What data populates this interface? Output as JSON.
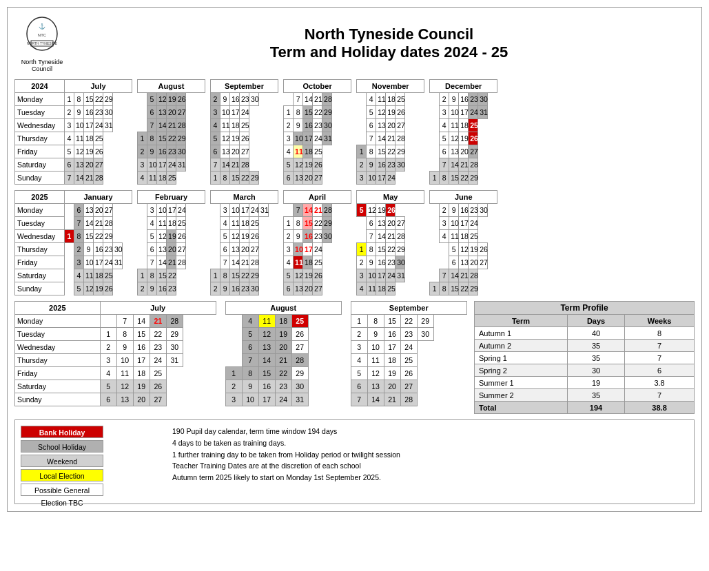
{
  "header": {
    "org_name": "North Tyneside Council",
    "title1": "North Tyneside Council",
    "title2": "Term and Holiday dates 2024 - 25"
  },
  "legend": {
    "items": [
      {
        "label": "Bank Holiday",
        "class": "lb-red"
      },
      {
        "label": "School Holiday",
        "class": "lb-gray"
      },
      {
        "label": "Weekend",
        "class": "lb-lgray"
      },
      {
        "label": "Local Election",
        "class": "lb-yellow"
      },
      {
        "label": "Possible General Election TBC",
        "class": "lb-white"
      }
    ],
    "notes": [
      "190 Pupil day calendar, term time window 194 days",
      "4  days to be taken as training days.",
      "1 further training day to be taken from Holiday period or twilight session",
      "Teacher Training Dates are at the discretion of each school",
      "Autumn term 2025 likely to start on Monday 1st September 2025."
    ]
  },
  "term_profile": {
    "title": "Term Profile",
    "headers": [
      "Term",
      "Days",
      "Weeks"
    ],
    "rows": [
      {
        "term": "Autumn 1",
        "days": "40",
        "weeks": "8"
      },
      {
        "term": "Autumn 2",
        "days": "35",
        "weeks": "7"
      },
      {
        "term": "Spring 1",
        "days": "35",
        "weeks": "7"
      },
      {
        "term": "Spring 2",
        "days": "30",
        "weeks": "6"
      },
      {
        "term": "Summer 1",
        "days": "19",
        "weeks": "3.8"
      },
      {
        "term": "Summer 2",
        "days": "35",
        "weeks": "7"
      },
      {
        "term": "Total",
        "days": "194",
        "weeks": "38.8"
      }
    ]
  }
}
